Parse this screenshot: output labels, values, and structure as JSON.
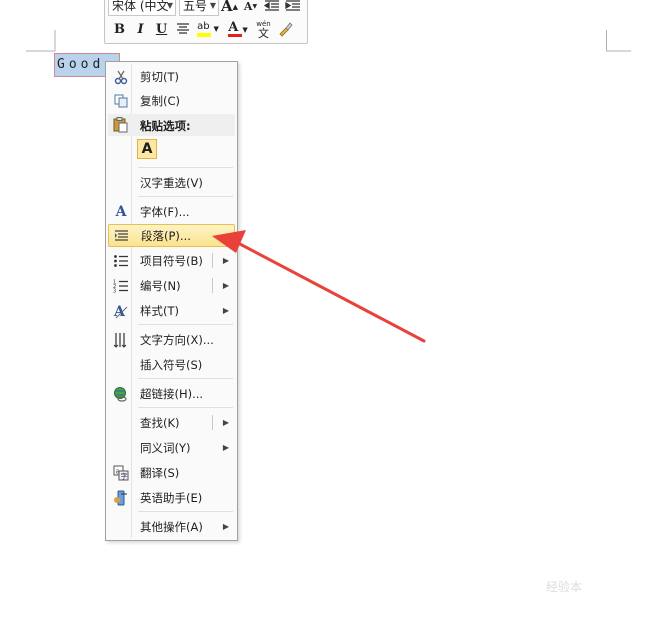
{
  "document": {
    "selected_text": "Good"
  },
  "mini_toolbar": {
    "font_name": "宋体 (中文",
    "font_size": "五号",
    "grow_font": "A",
    "shrink_font": "A",
    "bold": "B",
    "italic": "I",
    "underline": "U",
    "highlight": "ab",
    "font_color": "A",
    "phonetic_top": "wén",
    "phonetic_bottom": "文"
  },
  "context_menu": {
    "items": [
      {
        "label": "剪切(T)",
        "icon": "scissors-icon"
      },
      {
        "label": "复制(C)",
        "icon": "copy-icon"
      },
      {
        "label": "粘贴选项:",
        "icon": "clipboard-icon"
      },
      {
        "label": "A",
        "icon": "keep-text-only-icon"
      },
      {
        "label": "汉字重选(V)",
        "icon": ""
      },
      {
        "label": "字体(F)...",
        "icon": "font-icon"
      },
      {
        "label": "段落(P)...",
        "icon": "paragraph-icon"
      },
      {
        "label": "项目符号(B)",
        "icon": "bullets-icon"
      },
      {
        "label": "编号(N)",
        "icon": "numbering-icon"
      },
      {
        "label": "样式(T)",
        "icon": "styles-icon"
      },
      {
        "label": "文字方向(X)...",
        "icon": "text-direction-icon"
      },
      {
        "label": "插入符号(S)",
        "icon": ""
      },
      {
        "label": "超链接(H)...",
        "icon": "hyperlink-icon"
      },
      {
        "label": "查找(K)",
        "icon": ""
      },
      {
        "label": "同义词(Y)",
        "icon": ""
      },
      {
        "label": "翻译(S)",
        "icon": "translate-icon"
      },
      {
        "label": "英语助手(E)",
        "icon": "english-assistant-icon"
      },
      {
        "label": "其他操作(A)",
        "icon": ""
      }
    ]
  },
  "watermark": "经验本",
  "colors": {
    "highlight_menu_item": "#fbe38e",
    "arrow": "#e8423a",
    "selection": "#b9d3ec"
  }
}
